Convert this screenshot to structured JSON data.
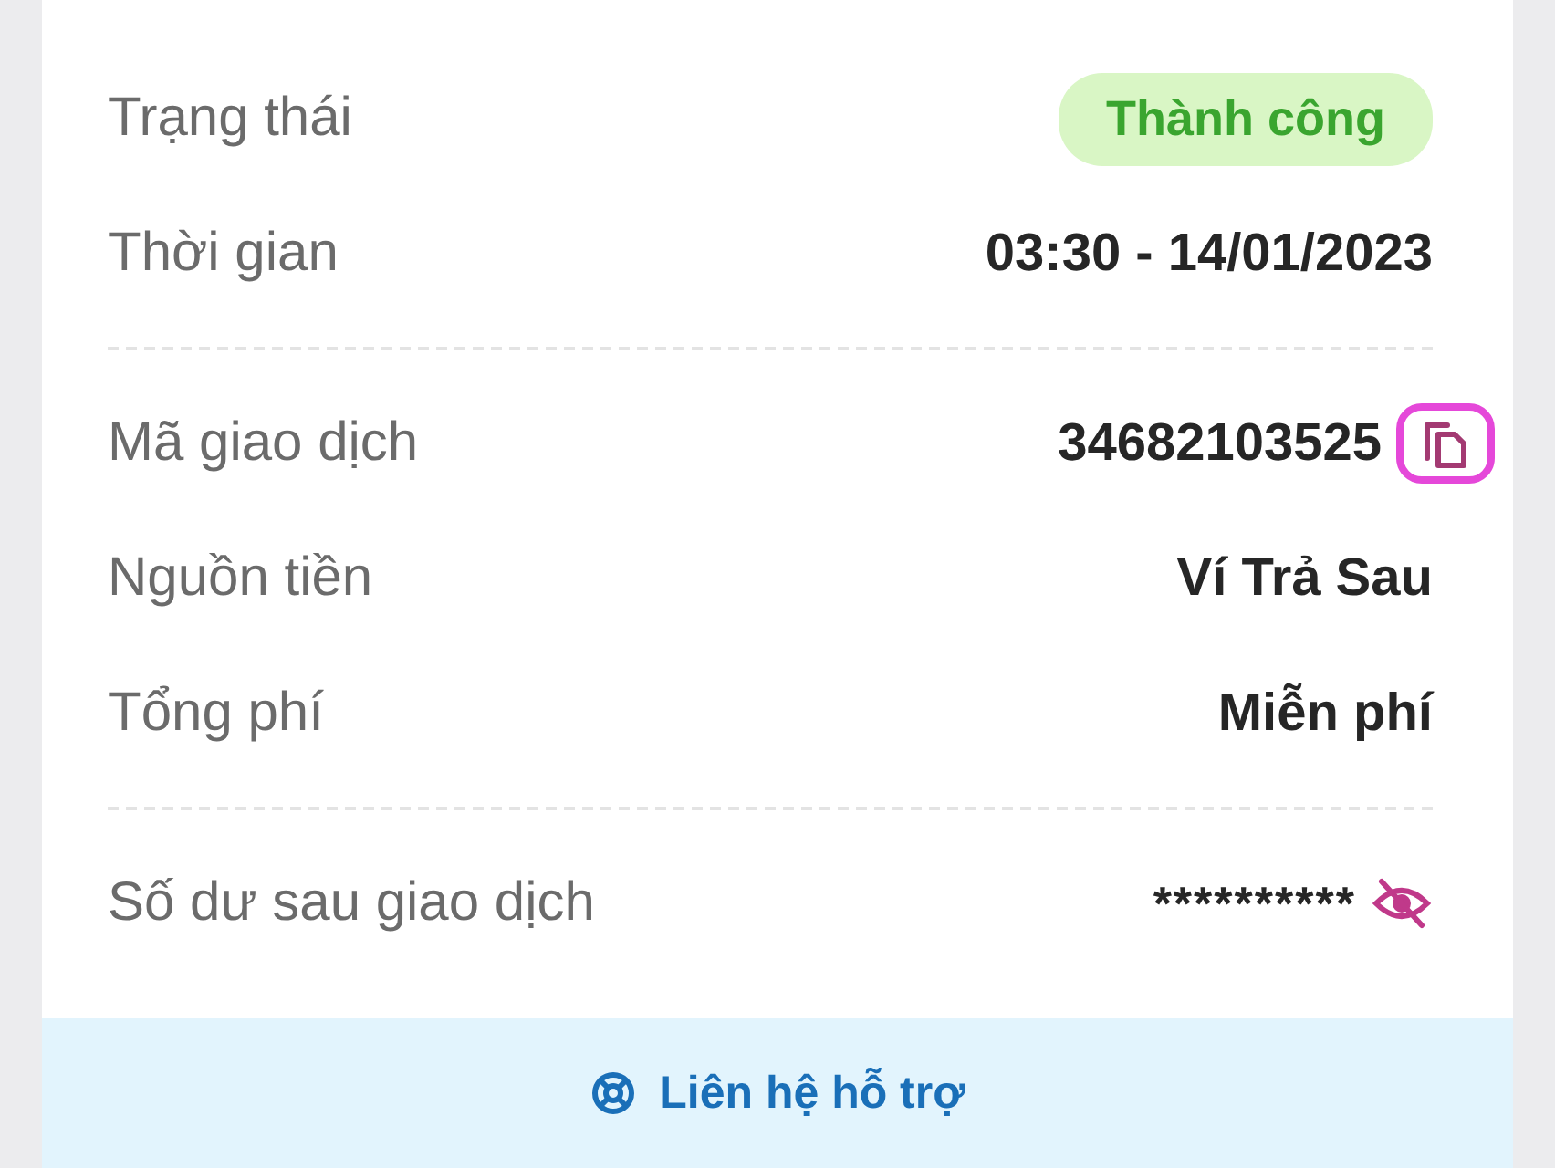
{
  "groups": [
    {
      "rows": [
        {
          "kind": "badge",
          "label": "Trạng thái",
          "value": "Thành công"
        },
        {
          "kind": "text",
          "label": "Thời gian",
          "value": "03:30 - 14/01/2023"
        }
      ]
    },
    {
      "rows": [
        {
          "kind": "copy",
          "label": "Mã giao dịch",
          "value": "34682103525"
        },
        {
          "kind": "text",
          "label": "Nguồn tiền",
          "value": "Ví Trả Sau"
        },
        {
          "kind": "text",
          "label": "Tổng phí",
          "value": "Miễn phí"
        }
      ]
    },
    {
      "rows": [
        {
          "kind": "hidden",
          "label": "Số dư sau giao dịch",
          "value": "**********"
        }
      ]
    }
  ],
  "footer": {
    "label": "Liên hệ hỗ trợ"
  }
}
